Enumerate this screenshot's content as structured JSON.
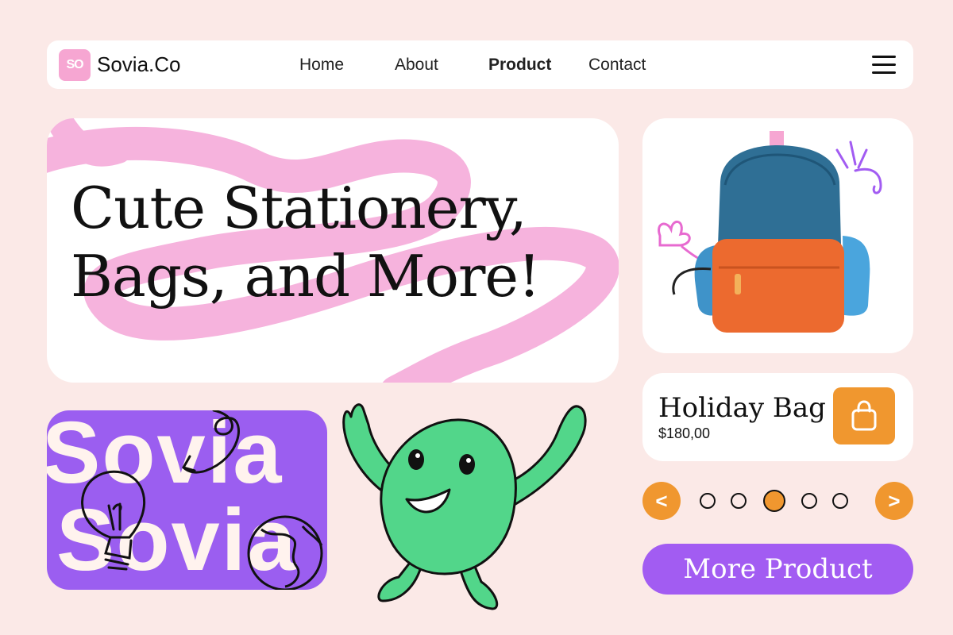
{
  "nav": {
    "logo_badge": "SO",
    "brand": "Sovia.Co",
    "links": [
      "Home",
      "About",
      "Product",
      "Contact"
    ],
    "active_link": "Product",
    "menu_icon": "hamburger-menu-icon"
  },
  "hero": {
    "line1": "Cute Stationery,",
    "line2": "Bags, and More!"
  },
  "product": {
    "name": "Holiday Bag",
    "price": "$180,00",
    "image": "backpack-image",
    "cart_icon": "shopping-bag-icon"
  },
  "carousel": {
    "prev_label": "<",
    "next_label": ">",
    "dot_count": 5,
    "active_dot": 3
  },
  "cta": {
    "label": "More Product"
  },
  "promo": {
    "word1": "Sovia",
    "word2": "Sovia"
  },
  "colors": {
    "background": "#fbe9e7",
    "pink": "#f6a6d2",
    "orange": "#f0972f",
    "purple": "#a25cf2",
    "green": "#52d68a"
  }
}
